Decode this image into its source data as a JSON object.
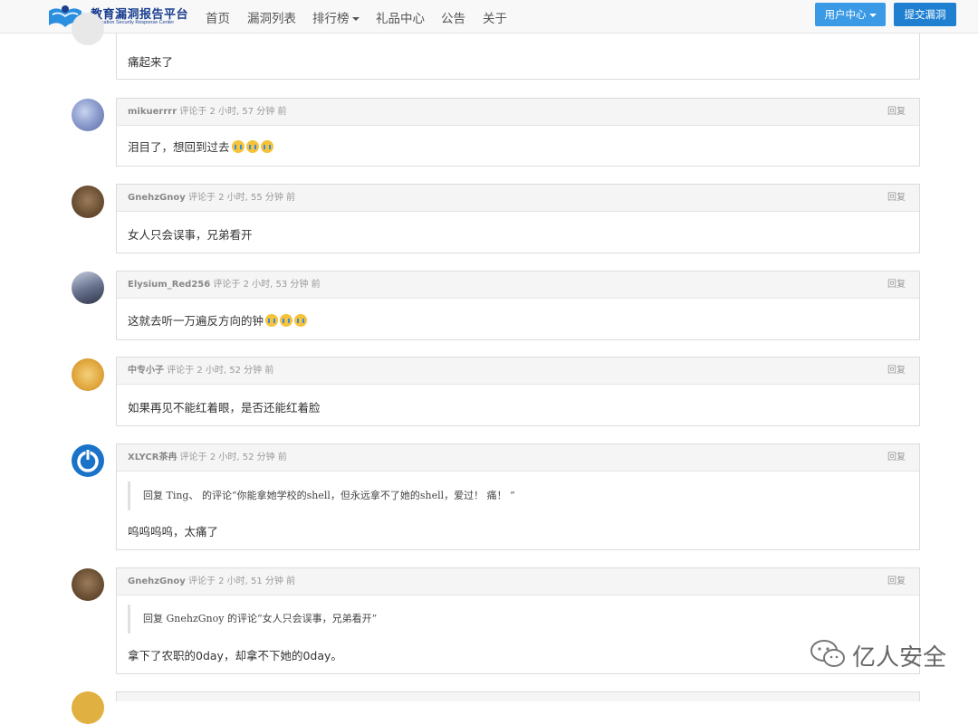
{
  "header": {
    "logo_title": "教育漏洞报告平台",
    "logo_subtitle": "Education Security Response Center",
    "nav": [
      "首页",
      "漏洞列表",
      "排行榜",
      "礼品中心",
      "公告",
      "关于"
    ],
    "user_center": "用户中心",
    "submit": "提交漏洞"
  },
  "comments": [
    {
      "text": "痛起来了"
    },
    {
      "user": "mikuerrrr",
      "meta": "评论于 2 小时, 57 分钟 前",
      "reply": "回复",
      "text": "泪目了，想回到过去",
      "emoji_count": 3
    },
    {
      "user": "GnehzGnoy",
      "meta": "评论于 2 小时, 55 分钟 前",
      "reply": "回复",
      "text": "女人只会误事，兄弟看开"
    },
    {
      "user": "Elysium_Red256",
      "meta": "评论于 2 小时, 53 分钟 前",
      "reply": "回复",
      "text": "这就去听一万遍反方向的钟",
      "emoji_count": 3
    },
    {
      "user": "中专小子",
      "meta": "评论于 2 小时, 52 分钟 前",
      "reply": "回复",
      "text": "如果再见不能红着眼，是否还能红着脸"
    },
    {
      "user": "XLYCR茶冉",
      "meta": "评论于 2 小时, 52 分钟 前",
      "reply": "回复",
      "quote": "回复 Ting、 的评论“你能拿她学校的shell，但永远拿不了她的shell，爱过！ 痛！ ”",
      "text": "呜呜呜呜，太痛了"
    },
    {
      "user": "GnehzGnoy",
      "meta": "评论于 2 小时, 51 分钟 前",
      "reply": "回复",
      "quote": "回复 GnehzGnoy 的评论“女人只会误事，兄弟看开”",
      "text": "拿下了农职的0day，却拿不下她的0day。"
    }
  ],
  "watermark": "亿人安全",
  "colors": {
    "primary": "#1f7fd0",
    "user_btn": "#3a9ae6",
    "logo": "#1a3f8f"
  }
}
